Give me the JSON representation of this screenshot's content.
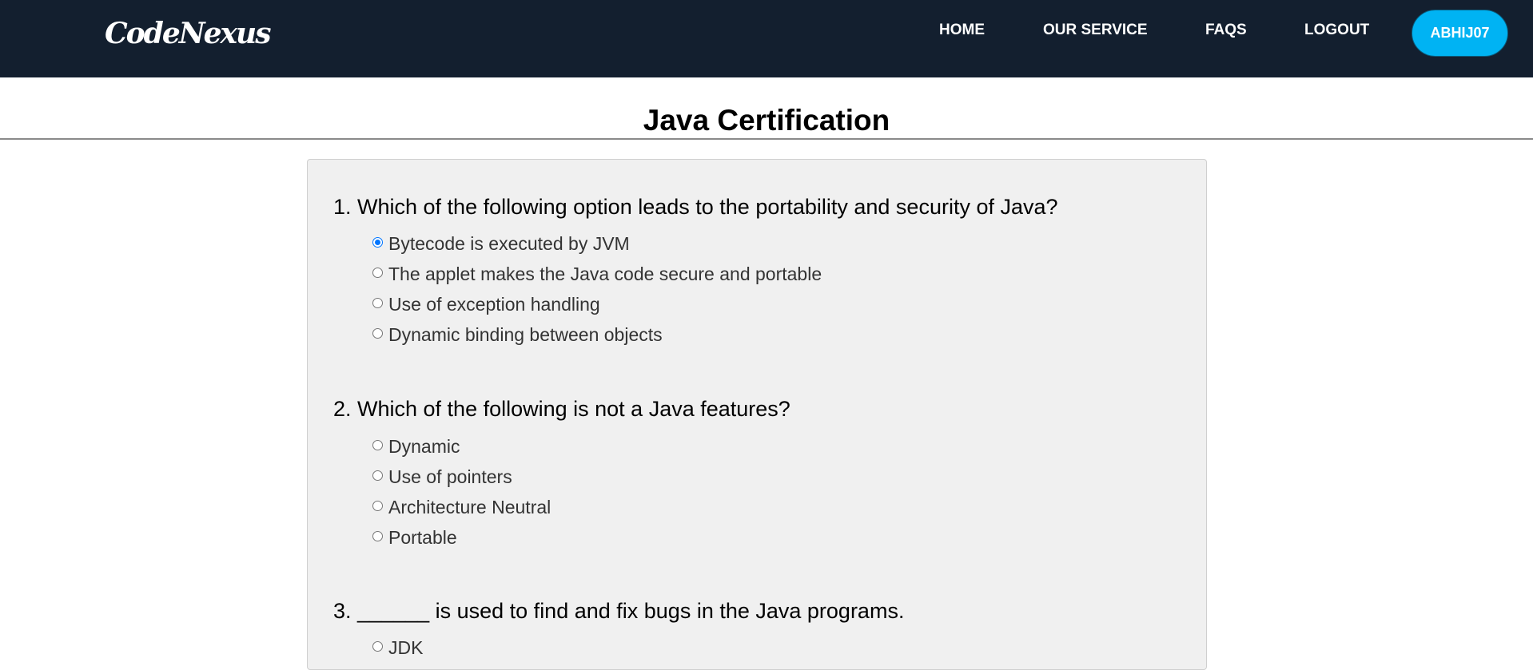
{
  "navbar": {
    "logo": "CodeNexus",
    "links": [
      "HOME",
      "OUR SERVICE",
      "FAQS",
      "LOGOUT"
    ],
    "user": "ABHIJ07",
    "colors": {
      "background": "#131f2f",
      "user_button": "#00b3f3"
    }
  },
  "page": {
    "title": "Java Certification"
  },
  "quiz": {
    "questions": [
      {
        "text": "1. Which of the following option leads to the portability and security of Java?",
        "options": [
          {
            "label": "Bytecode is executed by JVM",
            "checked": true
          },
          {
            "label": "The applet makes the Java code secure and portable",
            "checked": false
          },
          {
            "label": "Use of exception handling",
            "checked": false
          },
          {
            "label": "Dynamic binding between objects",
            "checked": false
          }
        ]
      },
      {
        "text": "2. Which of the following is not a Java features?",
        "options": [
          {
            "label": "Dynamic",
            "checked": false
          },
          {
            "label": "Use of pointers",
            "checked": false
          },
          {
            "label": "Architecture Neutral",
            "checked": false
          },
          {
            "label": "Portable",
            "checked": false
          }
        ]
      },
      {
        "text": "3. ______ is used to find and fix bugs in the Java programs.",
        "options": [
          {
            "label": "JDK",
            "checked": false
          }
        ]
      }
    ]
  }
}
